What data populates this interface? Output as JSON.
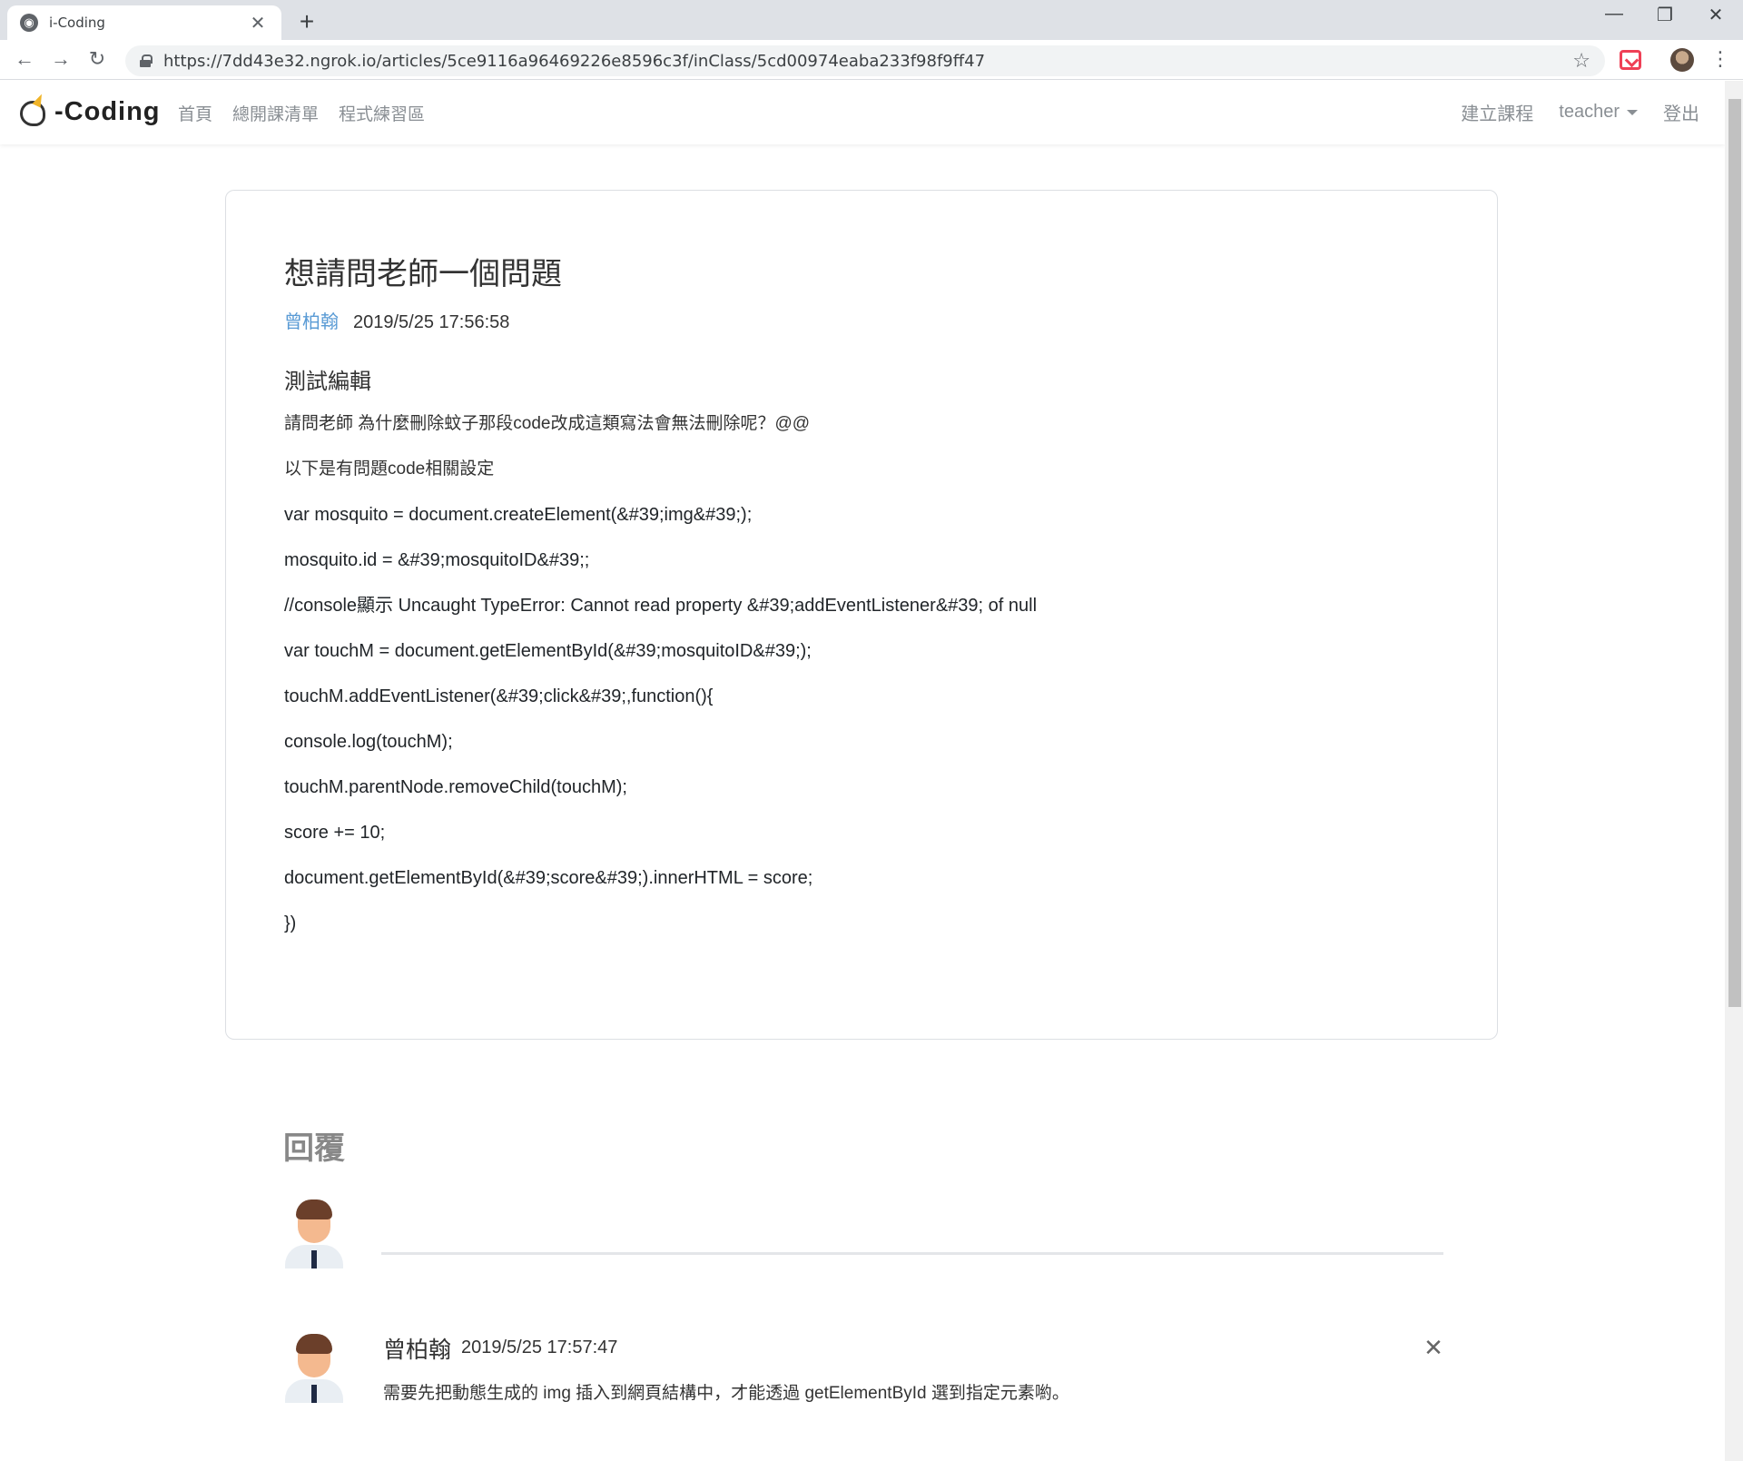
{
  "browser": {
    "tab_title": "i-Coding",
    "tab_close": "✕",
    "new_tab": "+",
    "url": "https://7dd43e32.ngrok.io/articles/5ce9116a96469226e8596c3f/inClass/5cd00974eaba233f98f9ff47",
    "back": "←",
    "forward": "→",
    "reload": "↻",
    "star": "☆",
    "menu": "⋮",
    "minimize": "—",
    "restore": "❐",
    "close": "✕"
  },
  "navbar": {
    "brand_text": "-Coding",
    "links": [
      "首頁",
      "總開課清單",
      "程式練習區"
    ],
    "create_course": "建立課程",
    "user": "teacher",
    "logout": "登出"
  },
  "article": {
    "title": "想請問老師一個問題",
    "author": "曾柏翰",
    "date": "2019/5/25 17:56:58",
    "subtitle": "測試編輯",
    "lines": [
      "請問老師 為什麼刪除蚊子那段code改成這類寫法會無法刪除呢？@@",
      "以下是有問題code相關設定",
      "var mosquito = document.createElement(&#39;img&#39;);",
      "mosquito.id = &#39;mosquitoID&#39;;",
      "//console顯示 Uncaught TypeError: Cannot read property &#39;addEventListener&#39; of null",
      "var touchM = document.getElementById(&#39;mosquitoID&#39;);",
      "touchM.addEventListener(&#39;click&#39;,function(){",
      "console.log(touchM);",
      "touchM.parentNode.removeChild(touchM);",
      "score += 10;",
      "document.getElementById(&#39;score&#39;).innerHTML = score;",
      "})"
    ]
  },
  "replies": {
    "heading": "回覆",
    "items": [
      {
        "name": "曾柏翰",
        "date": "2019/5/25 17:57:47",
        "text": "需要先把動態生成的 img 插入到網頁結構中，才能透過 getElementById 選到指定元素喲。",
        "close": "✕"
      }
    ]
  },
  "colors": {
    "author_link": "#5a9bd5",
    "nav_text": "#8a8f94"
  }
}
